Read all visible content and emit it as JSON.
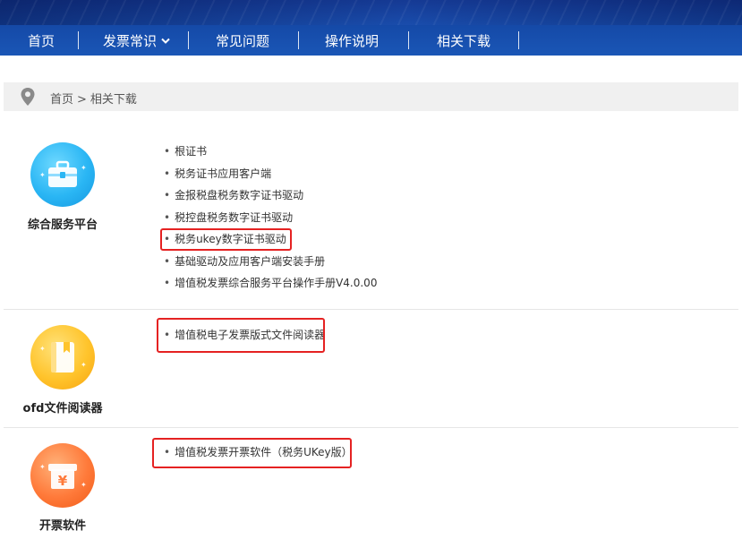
{
  "nav": {
    "items": [
      {
        "label": "首页"
      },
      {
        "label": "发票常识",
        "dropdown": true
      },
      {
        "label": "常见问题"
      },
      {
        "label": "操作说明"
      },
      {
        "label": "相关下载"
      }
    ]
  },
  "breadcrumb": {
    "home": "首页",
    "separator": ">",
    "current": "相关下载",
    "icon": "location-pin-icon"
  },
  "sections": [
    {
      "title": "综合服务平台",
      "icon": "briefcase-icon",
      "links": [
        "根证书",
        "税务证书应用客户端",
        "金报税盘税务数字证书驱动",
        "税控盘税务数字证书驱动",
        "税务ukey数字证书驱动",
        "基础驱动及应用客户端安装手册",
        "增值税发票综合服务平台操作手册V4.0.00"
      ]
    },
    {
      "title": "ofd文件阅读器",
      "icon": "book-icon",
      "links": [
        "增值税电子发票版式文件阅读器"
      ]
    },
    {
      "title": "开票软件",
      "icon": "yuan-invoice-icon",
      "links": [
        "增值税发票开票软件（税务UKey版）"
      ]
    }
  ],
  "colors": {
    "nav_bg": "#1a56b6",
    "highlight_border": "#e52222",
    "blue_icon": "#2ab6f4",
    "yellow_icon": "#ffc42c",
    "orange_icon": "#ff7a3a"
  }
}
